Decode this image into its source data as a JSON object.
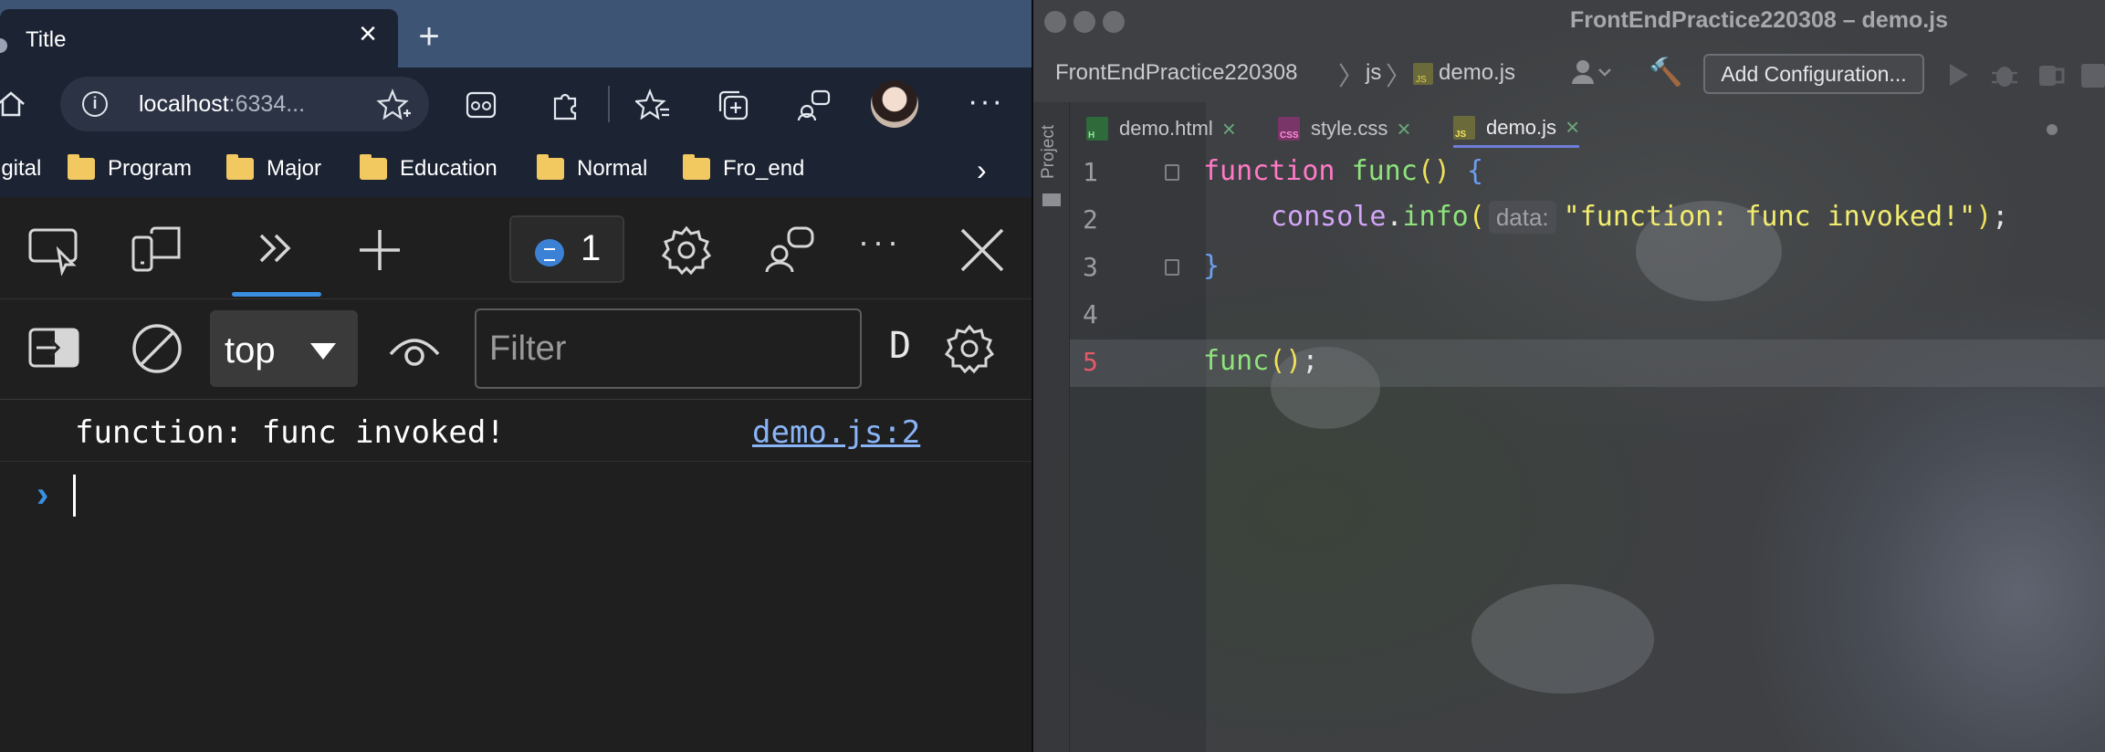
{
  "browser": {
    "tab": {
      "title": "Title",
      "close": "×"
    },
    "new_tab": "+",
    "address": {
      "host": "localhost",
      "port_truncated": ":6334..."
    },
    "bookmarks": [
      {
        "label": "igital"
      },
      {
        "label": "Program"
      },
      {
        "label": "Major"
      },
      {
        "label": "Education"
      },
      {
        "label": "Normal"
      },
      {
        "label": "Fro_end"
      }
    ],
    "more_menu": "···",
    "bookmarks_chevron": "›"
  },
  "devtools": {
    "message_count": "1",
    "context_select": "top",
    "filter_placeholder": "Filter",
    "cut_label": "D",
    "log": {
      "message": "function: func invoked!",
      "source": "demo.js:2"
    },
    "prompt": "›",
    "accent_color": "#3a8fe0"
  },
  "ide": {
    "window_title": "FrontEndPractice220308 – demo.js",
    "breadcrumb": [
      "FrontEndPractice220308",
      "js",
      "demo.js"
    ],
    "add_configuration": "Add Configuration...",
    "side_panel_label": "Project",
    "tabs": [
      {
        "label": "demo.html",
        "badge": "H",
        "badge_color": "#3e8f4f"
      },
      {
        "label": "style.css",
        "badge": "CSS",
        "badge_color": "#a44a8e"
      },
      {
        "label": "demo.js",
        "badge": "JS",
        "badge_color": "#8d8a3a",
        "active": true
      }
    ],
    "line_numbers": [
      "1",
      "2",
      "3",
      "4",
      "5"
    ],
    "code": {
      "l1_kw": "function",
      "l1_fn": "func",
      "l1_par": "()",
      "l1_brace": "{",
      "l2_obj": "console",
      "l2_dot": ".",
      "l2_fn": "info",
      "l2_open": "(",
      "l2_hint": "data:",
      "l2_str": "\"function: func invoked!\"",
      "l2_close": ")",
      "l2_semi": ";",
      "l3_brace": "}",
      "l5_fn": "func",
      "l5_par": "()",
      "l5_semi": ";"
    }
  }
}
